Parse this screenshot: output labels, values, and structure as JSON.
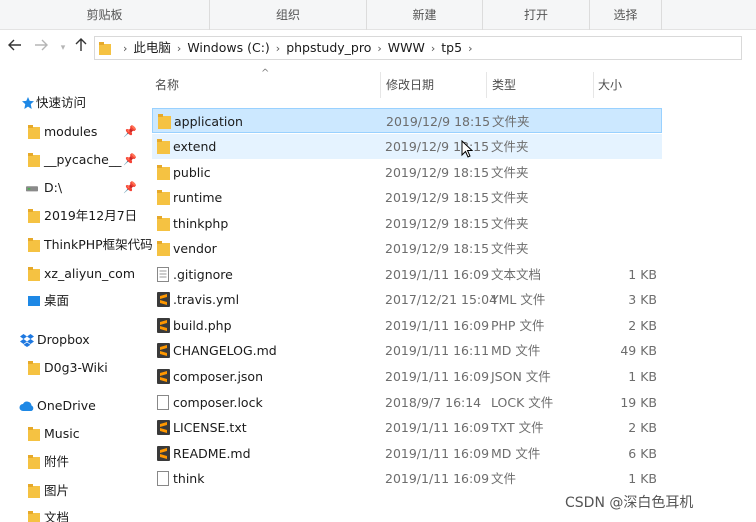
{
  "ribbon": {
    "groups": [
      "剪贴板",
      "组织",
      "新建",
      "打开",
      "选择"
    ]
  },
  "nav": {
    "back_icon": "back-arrow-icon",
    "forward_icon": "forward-arrow-icon",
    "up_icon": "up-arrow-icon"
  },
  "address": {
    "crumbs": [
      "此电脑",
      "Windows (C:)",
      "phpstudy_pro",
      "WWW",
      "tp5"
    ]
  },
  "sidebar": {
    "items": [
      {
        "label": "快速访问",
        "icon": "star-icon"
      },
      {
        "label": "modules",
        "icon": "folder-icon",
        "pinned": true
      },
      {
        "label": "__pycache__",
        "icon": "folder-icon",
        "pinned": true
      },
      {
        "label": "D:\\",
        "icon": "drive-icon",
        "pinned": true
      },
      {
        "label": "2019年12月7日",
        "icon": "folder-icon",
        "pinned": false
      },
      {
        "label": "ThinkPHP框架代码",
        "icon": "folder-icon",
        "pinned": false
      },
      {
        "label": "xz_aliyun_com",
        "icon": "folder-icon",
        "pinned": false
      },
      {
        "label": "桌面",
        "icon": "desktop-icon",
        "pinned": false
      },
      {
        "label": "Dropbox",
        "icon": "dropbox-icon",
        "pinned": false
      },
      {
        "label": "D0g3-Wiki",
        "icon": "folder-icon",
        "pinned": false
      },
      {
        "label": "OneDrive",
        "icon": "cloud-icon",
        "pinned": false
      },
      {
        "label": "Music",
        "icon": "folder-icon",
        "pinned": false
      },
      {
        "label": "附件",
        "icon": "folder-icon",
        "pinned": false
      },
      {
        "label": "图片",
        "icon": "folder-icon",
        "pinned": false
      },
      {
        "label": "文档",
        "icon": "folder-icon",
        "pinned": false
      }
    ]
  },
  "columns": {
    "name": "名称",
    "date": "修改日期",
    "type": "类型",
    "size": "大小"
  },
  "files": [
    {
      "name": "application",
      "date": "2019/12/9 18:15",
      "type": "文件夹",
      "size": "",
      "icon": "folder-icon",
      "state": "selected"
    },
    {
      "name": "extend",
      "date": "2019/12/9 18:15",
      "type": "文件夹",
      "size": "",
      "icon": "folder-icon",
      "state": "hover"
    },
    {
      "name": "public",
      "date": "2019/12/9 18:15",
      "type": "文件夹",
      "size": "",
      "icon": "folder-icon",
      "state": ""
    },
    {
      "name": "runtime",
      "date": "2019/12/9 18:15",
      "type": "文件夹",
      "size": "",
      "icon": "folder-icon",
      "state": ""
    },
    {
      "name": "thinkphp",
      "date": "2019/12/9 18:15",
      "type": "文件夹",
      "size": "",
      "icon": "folder-icon",
      "state": ""
    },
    {
      "name": "vendor",
      "date": "2019/12/9 18:15",
      "type": "文件夹",
      "size": "",
      "icon": "folder-icon",
      "state": ""
    },
    {
      "name": ".gitignore",
      "date": "2019/1/11 16:09",
      "type": "文本文档",
      "size": "1 KB",
      "icon": "text-file-icon",
      "state": ""
    },
    {
      "name": ".travis.yml",
      "date": "2017/12/21 15:04",
      "type": "YML 文件",
      "size": "3 KB",
      "icon": "sublime-file-icon",
      "state": ""
    },
    {
      "name": "build.php",
      "date": "2019/1/11 16:09",
      "type": "PHP 文件",
      "size": "2 KB",
      "icon": "sublime-file-icon",
      "state": ""
    },
    {
      "name": "CHANGELOG.md",
      "date": "2019/1/11 16:11",
      "type": "MD 文件",
      "size": "49 KB",
      "icon": "sublime-file-icon",
      "state": ""
    },
    {
      "name": "composer.json",
      "date": "2019/1/11 16:09",
      "type": "JSON 文件",
      "size": "1 KB",
      "icon": "sublime-file-icon",
      "state": ""
    },
    {
      "name": "composer.lock",
      "date": "2018/9/7 16:14",
      "type": "LOCK 文件",
      "size": "19 KB",
      "icon": "blank-file-icon",
      "state": ""
    },
    {
      "name": "LICENSE.txt",
      "date": "2019/1/11 16:09",
      "type": "TXT 文件",
      "size": "2 KB",
      "icon": "sublime-file-icon",
      "state": ""
    },
    {
      "name": "README.md",
      "date": "2019/1/11 16:09",
      "type": "MD 文件",
      "size": "6 KB",
      "icon": "sublime-file-icon",
      "state": ""
    },
    {
      "name": "think",
      "date": "2019/1/11 16:09",
      "type": "文件",
      "size": "1 KB",
      "icon": "blank-file-icon",
      "state": ""
    }
  ],
  "watermark": "CSDN @深白色耳机",
  "colors": {
    "selected_bg": "#cce8ff",
    "hover_bg": "#e5f3ff",
    "folder": "#f5c242",
    "sublime": "#ff9800",
    "accent_blue": "#1e88e5"
  }
}
